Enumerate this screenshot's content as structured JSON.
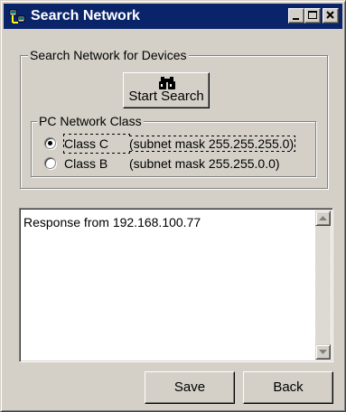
{
  "window": {
    "title": "Search Network",
    "icons": {
      "app": "network-app-icon",
      "minimize": "minimize-icon",
      "maximize": "maximize-icon",
      "close": "close-icon"
    }
  },
  "search_group": {
    "label": "Search Network for Devices",
    "start_button": {
      "label": "Start Search",
      "icon": "binoculars-icon"
    }
  },
  "class_group": {
    "label": "PC Network Class",
    "options": [
      {
        "name": "Class C",
        "detail": "(subnet mask 255.255.255.0)",
        "selected": true
      },
      {
        "name": "Class B",
        "detail": "(subnet mask 255.255.0.0)",
        "selected": false
      }
    ]
  },
  "results": {
    "lines": [
      "Response from 192.168.100.77"
    ]
  },
  "buttons": {
    "save": "Save",
    "back": "Back"
  },
  "colors": {
    "titlebar": "#0a246a",
    "face": "#d4d0c8",
    "list_bg": "#ffffff"
  }
}
